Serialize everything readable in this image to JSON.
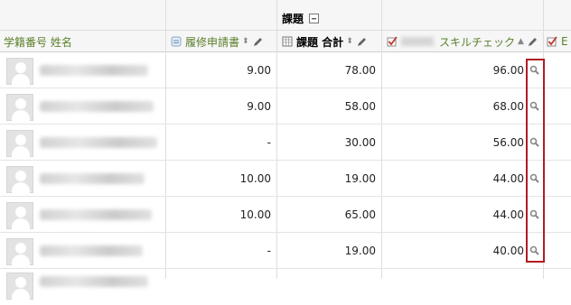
{
  "header": {
    "group_label": "課題",
    "col_name": "学籍番号 姓名",
    "col_a": "履修申請書",
    "col_b": "課題 合計",
    "col_c": "スキルチェック",
    "col_d": "E"
  },
  "rows": [
    {
      "a": "9.00",
      "b": "78.00",
      "c": "96.00"
    },
    {
      "a": "9.00",
      "b": "58.00",
      "c": "68.00"
    },
    {
      "a": "-",
      "b": "30.00",
      "c": "56.00"
    },
    {
      "a": "10.00",
      "b": "19.00",
      "c": "44.00"
    },
    {
      "a": "10.00",
      "b": "65.00",
      "c": "44.00"
    },
    {
      "a": "-",
      "b": "19.00",
      "c": "40.00"
    }
  ],
  "icons": {
    "collapse": "collapse-icon",
    "calc": "calculator-icon",
    "check": "checked-assignment-icon",
    "edit": "pencil-icon",
    "analysis": "magnifier-icon"
  },
  "colors": {
    "highlight_box": "#b11c24",
    "header_link": "#5b7f2b"
  }
}
